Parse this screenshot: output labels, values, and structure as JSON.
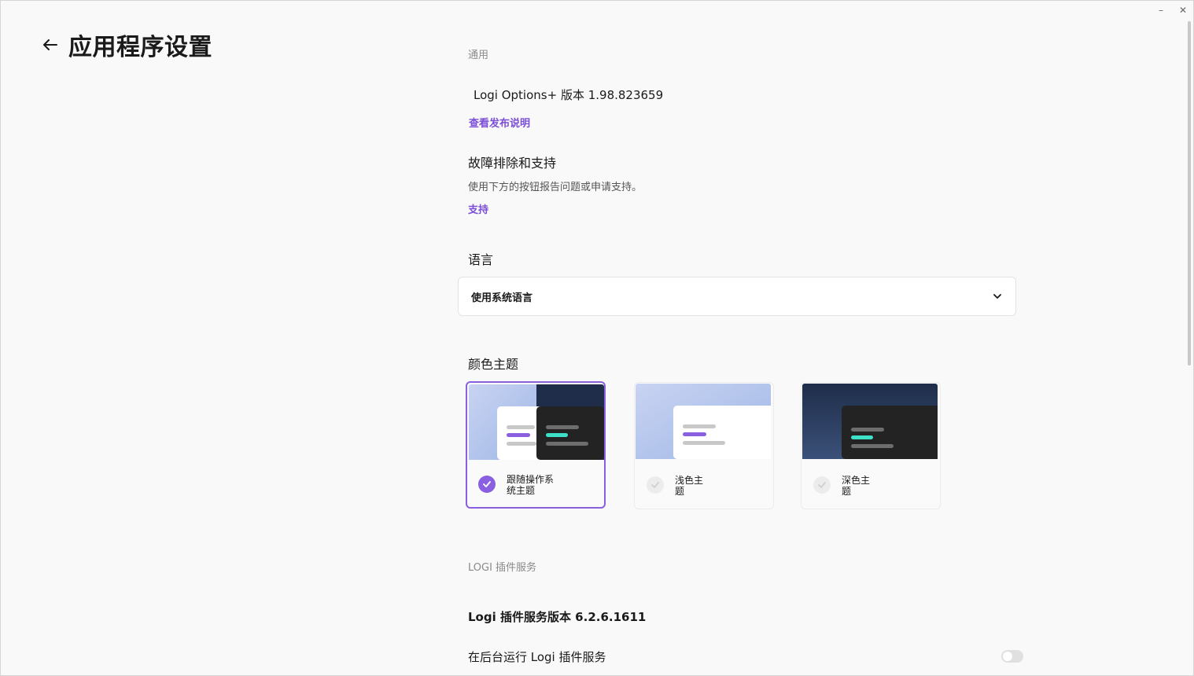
{
  "window": {
    "minimize_label": "–",
    "close_label": "✕"
  },
  "header": {
    "title": "应用程序设置",
    "back_icon": "arrow-left-icon"
  },
  "general": {
    "section_label": "通用",
    "version_text": "Logi Options+ 版本 1.98.823659",
    "release_notes_link": "查看发布说明"
  },
  "support": {
    "heading": "故障排除和支持",
    "description": "使用下方的按钮报告问题或申请支持。",
    "link": "支持"
  },
  "language": {
    "heading": "语言",
    "selected": "使用系统语言"
  },
  "theme": {
    "heading": "颜色主题",
    "options": [
      {
        "label": "跟随操作系统主题",
        "selected": true
      },
      {
        "label": "浅色主题",
        "selected": false
      },
      {
        "label": "深色主题",
        "selected": false
      }
    ],
    "colors": {
      "accent": "#8a5fe0",
      "teal": "#3ee0c8",
      "dark": "#232323",
      "navy": "#1f2d4a"
    }
  },
  "plugin": {
    "section_label": "LOGI 插件服务",
    "version_text": "Logi 插件服务版本 6.2.6.1611",
    "background_run_label": "在后台运行 Logi 插件服务",
    "background_run_enabled": false
  }
}
